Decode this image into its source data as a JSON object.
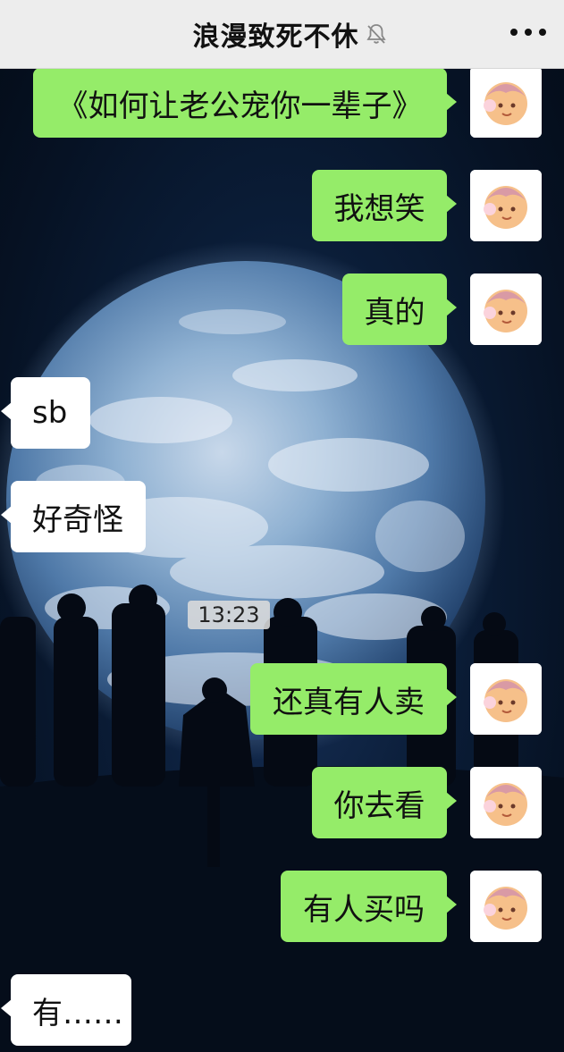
{
  "header": {
    "title": "浪漫致死不休",
    "mute_icon": "bell-slash-icon",
    "more_icon": "more-dots-icon"
  },
  "colors": {
    "header_bg": "#ededed",
    "my_bubble": "#95ec69",
    "other_bubble": "#ffffff"
  },
  "timestamp": "13:23",
  "messages": [
    {
      "sender": "me",
      "text": "《如何让老公宠你一辈子》"
    },
    {
      "sender": "me",
      "text": "我想笑"
    },
    {
      "sender": "me",
      "text": "真的"
    },
    {
      "sender": "other",
      "text": "sb"
    },
    {
      "sender": "other",
      "text": "好奇怪"
    },
    {
      "sender": "me",
      "text": "还真有人卖"
    },
    {
      "sender": "me",
      "text": "你去看"
    },
    {
      "sender": "me",
      "text": "有人买吗"
    },
    {
      "sender": "other",
      "text": "有……"
    }
  ]
}
